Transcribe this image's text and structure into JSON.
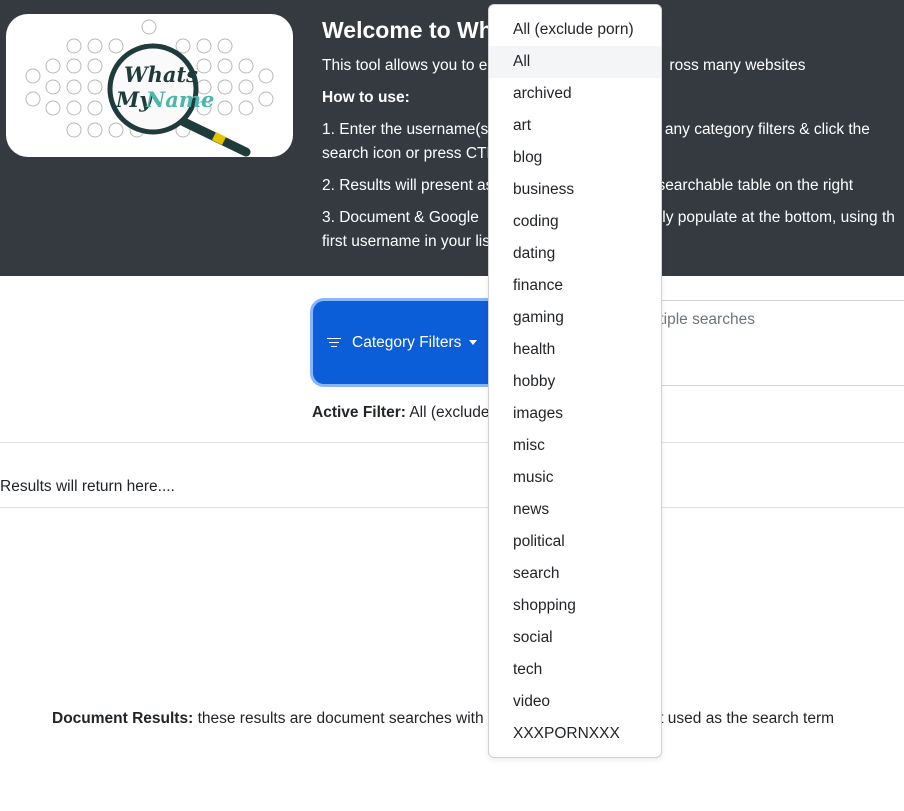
{
  "hero": {
    "logo_text_top": "Whats",
    "logo_text_bottom": "My",
    "logo_text_bottom2": "Name",
    "title": "Welcome to Wh",
    "intro": "This tool allows you to e",
    "intro_tail": "ross many websites",
    "howto": "How to use:",
    "step1_a": "1. Enter the username(s",
    "step1_a_tail": "t any category filters & click the",
    "step1_b": "search icon or press CTR",
    "step2": "2. Results will present as",
    "step2_tail": "searchable table on the right",
    "step3_a": "3. Document & Google",
    "step3_a_tail": "lly populate at the bottom, using th",
    "step3_b": "first username in your lis"
  },
  "filter_button": {
    "label": "Category Filters",
    "icon": "filter-icon"
  },
  "search": {
    "placeholder": "s on each line for multiple searches"
  },
  "active_filter": {
    "label": "Active Filter:",
    "value": "All (exclude"
  },
  "results": {
    "text": "Results will return here...."
  },
  "document_results": {
    "label": "Document Results:",
    "text": "these results are document searches with",
    "tail": "e list used as the search term"
  },
  "dropdown": {
    "items": [
      "All (exclude porn)",
      "All",
      "archived",
      "art",
      "blog",
      "business",
      "coding",
      "dating",
      "finance",
      "gaming",
      "health",
      "hobby",
      "images",
      "misc",
      "music",
      "news",
      "political",
      "search",
      "shopping",
      "social",
      "tech",
      "video",
      "XXXPORNXXX"
    ],
    "highlighted": "All"
  },
  "colors": {
    "hero_bg": "#343a40",
    "primary": "#0b5ed7",
    "logo_teal": "#4db6ac",
    "logo_dark": "#1f3b3b"
  }
}
